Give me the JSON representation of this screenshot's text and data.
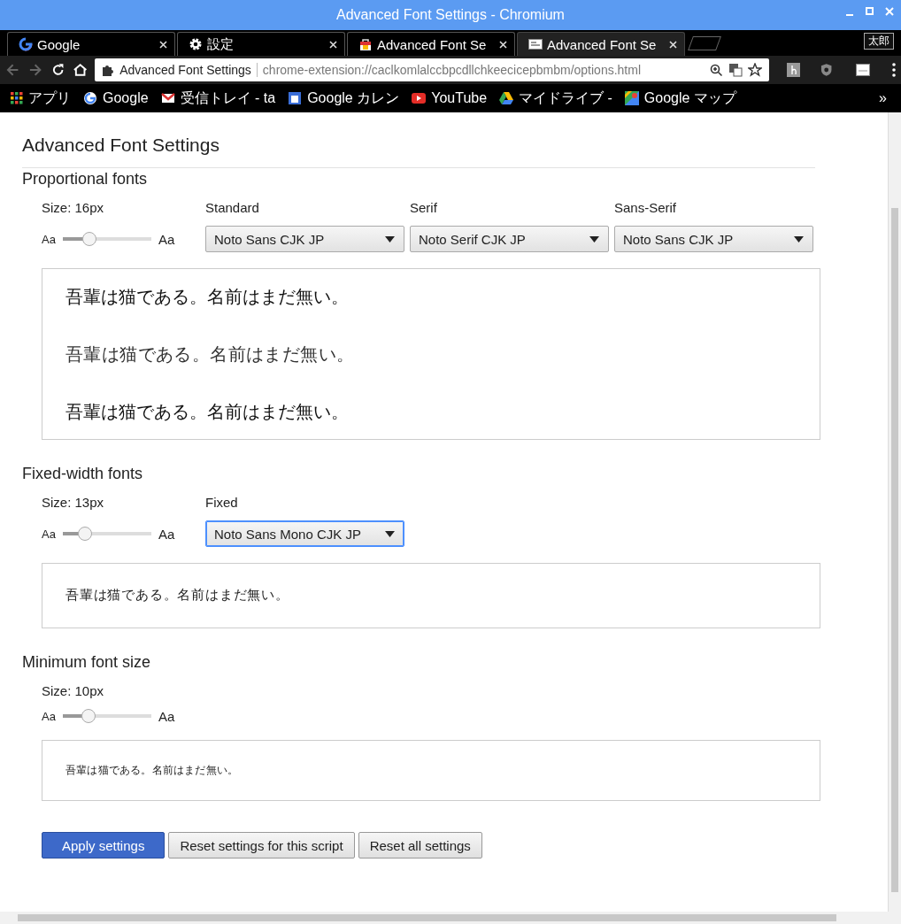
{
  "window": {
    "title": "Advanced Font Settings - Chromium",
    "profile": "太郎"
  },
  "tabs": [
    {
      "label": "Google",
      "selected": false
    },
    {
      "label": "設定",
      "selected": false
    },
    {
      "label": "Advanced Font Se",
      "selected": false
    },
    {
      "label": "Advanced Font Se",
      "selected": true
    }
  ],
  "address_bar": {
    "page_label": "Advanced Font Settings",
    "url": "chrome-extension://caclkomlalccbpcdllchkeecicepbmbm/options.html"
  },
  "bookmarks": [
    {
      "label": "アプリ"
    },
    {
      "label": "Google"
    },
    {
      "label": "受信トレイ - ta"
    },
    {
      "label": "Google カレン"
    },
    {
      "label": "YouTube"
    },
    {
      "label": "マイドライブ -"
    },
    {
      "label": "Google マップ"
    }
  ],
  "bookmarks_more": "»",
  "page": {
    "title": "Advanced Font Settings",
    "sections": [
      {
        "heading": "Proportional fonts",
        "size_label": "Size: 16px",
        "slider": {
          "min_label": "Aa",
          "max_label": "Aa",
          "level": 0.26
        },
        "selects": [
          {
            "label": "Standard",
            "value": "Noto Sans CJK JP",
            "focused": false
          },
          {
            "label": "Serif",
            "value": "Noto Serif CJK JP",
            "focused": false
          },
          {
            "label": "Sans-Serif",
            "value": "Noto Sans CJK JP",
            "focused": false
          }
        ],
        "previews": [
          {
            "kind": "sans",
            "text": "吾輩は猫である。名前はまだ無い。"
          },
          {
            "kind": "serif",
            "text": "吾輩は猫である。名前はまだ無い。"
          },
          {
            "kind": "sans",
            "text": "吾輩は猫である。名前はまだ無い。"
          }
        ]
      },
      {
        "heading": "Fixed-width fonts",
        "size_label": "Size: 13px",
        "slider": {
          "min_label": "Aa",
          "max_label": "Aa",
          "level": 0.2
        },
        "selects": [
          {
            "label": "Fixed",
            "value": "Noto Sans Mono CJK JP",
            "focused": true
          }
        ],
        "previews": [
          {
            "kind": "fixed",
            "text": "吾輩は猫である。名前はまだ無い。"
          }
        ]
      },
      {
        "heading": "Minimum font size",
        "size_label": "Size: 10px",
        "slider": {
          "min_label": "Aa",
          "max_label": "Aa",
          "level": 0.25
        },
        "previews": [
          {
            "kind": "minimum",
            "text": "吾輩は猫である。名前はまだ無い。"
          }
        ]
      }
    ],
    "buttons": [
      {
        "label": "Apply settings",
        "kind": "primary"
      },
      {
        "label": "Reset settings for this script",
        "kind": "normal"
      },
      {
        "label": "Reset all settings",
        "kind": "normal"
      }
    ]
  }
}
